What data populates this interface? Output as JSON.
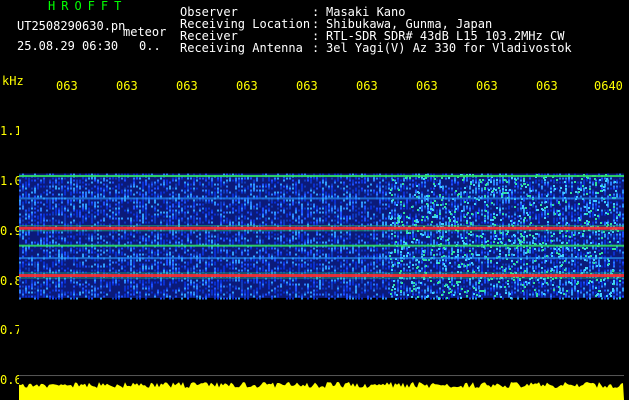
{
  "header": {
    "app_title": "HROFFT",
    "filename": "UT2508290630.pn",
    "type_label": "meteor",
    "datetime": "25.08.29 06:30",
    "count": "0.."
  },
  "info": [
    {
      "label": "Observer",
      "value": "Masaki Kano"
    },
    {
      "label": "Receiving Location",
      "value": "Shibukawa, Gunma, Japan"
    },
    {
      "label": "Receiver",
      "value": "RTL-SDR SDR# 43dB L15 103.2MHz CW"
    },
    {
      "label": "Receiving Antenna",
      "value": "3el Yagi(V) Az 330 for Vladivostok"
    }
  ],
  "colors": {
    "background": "#000000",
    "text_header": "#ffffff",
    "text_axis": "#ffff00",
    "title": "#00ff00",
    "signal_band": "#ffff00",
    "noise": "#0a2fd0",
    "line_strong": "#ff3030",
    "line_medium": "#30e060"
  },
  "chart_data": {
    "type": "heatmap",
    "ylabel": "kHz",
    "y_ticks": [
      "1.1",
      "1.0",
      "0.9",
      "0.8",
      "0.7",
      "0.6"
    ],
    "ylim": [
      0.6,
      1.15
    ],
    "x_ticks": [
      "063",
      "063",
      "063",
      "063",
      "063",
      "063",
      "063",
      "063",
      "063",
      "0640"
    ],
    "noise_band_khz": [
      0.765,
      1.015
    ],
    "lines_khz": [
      {
        "freq": 1.01,
        "strength": "medium"
      },
      {
        "freq": 0.965,
        "strength": "weak"
      },
      {
        "freq": 0.905,
        "strength": "strong"
      },
      {
        "freq": 0.87,
        "strength": "medium"
      },
      {
        "freq": 0.845,
        "strength": "weak"
      },
      {
        "freq": 0.81,
        "strength": "strong"
      }
    ],
    "bottom_band_label": "signal level"
  }
}
